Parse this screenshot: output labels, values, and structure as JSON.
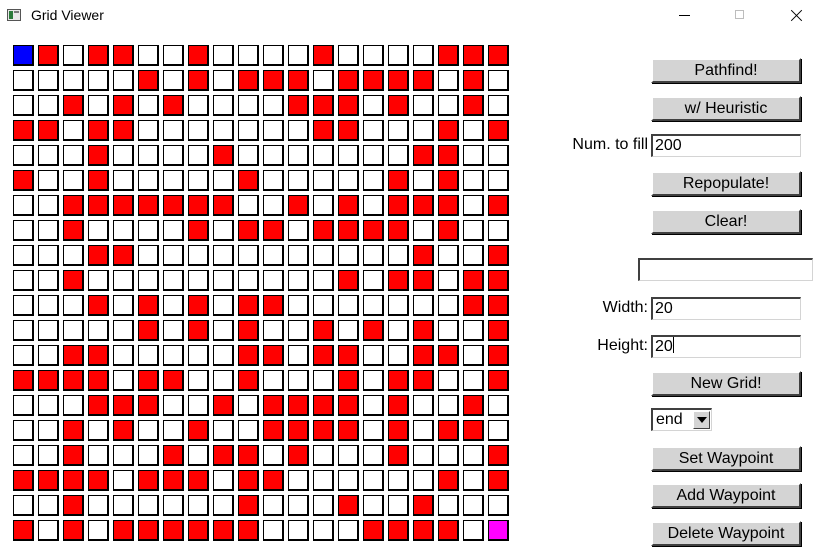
{
  "window": {
    "title": "Grid Viewer"
  },
  "colors": {
    "empty": "#ffffff",
    "wall": "#ff0000",
    "start": "#0000ff",
    "end": "#ff00ff"
  },
  "grid": {
    "rows": 20,
    "cols": 20,
    "legend": {
      ".": "empty",
      "#": "wall",
      "S": "start",
      "E": "end"
    },
    "cells": [
      "S#.##..#....#....###",
      ".....#.#.###.####.#.",
      "..#.#.#....###.#..#.",
      "##.##.......##...#.#",
      "...#....#.......##..",
      "#..#.....#.....#.#..",
      "..#######..#.#.###.#",
      "..#....#.##.####.#..",
      "...##...........#..#",
      "..#..........#.##.##",
      "...#.#.#.##.......##",
      ".....#.#.#..#.#.#..#",
      "..##.....##.##..##.#",
      "####.##..#...#.##..#",
      "...###..#.####.#..#.",
      "..#.#..#..####.#.##.",
      "..#...#.##.#...#...#",
      "####.###.##......#.#",
      "..#......#...#..#...",
      "#.#.######....####.E"
    ]
  },
  "controls": {
    "pathfind_label": "Pathfind!",
    "heuristic_label": "w/ Heuristic",
    "num_to_fill_label": "Num. to fill",
    "num_to_fill_value": "200",
    "repopulate_label": "Repopulate!",
    "clear_label": "Clear!",
    "extra_field_value": "",
    "width_label": "Width:",
    "width_value": "20",
    "height_label": "Height:",
    "height_value": "20",
    "new_grid_label": "New Grid!",
    "waypoint_select_value": "end",
    "set_waypoint_label": "Set Waypoint",
    "add_waypoint_label": "Add Waypoint",
    "delete_waypoint_label": "Delete Waypoint"
  }
}
